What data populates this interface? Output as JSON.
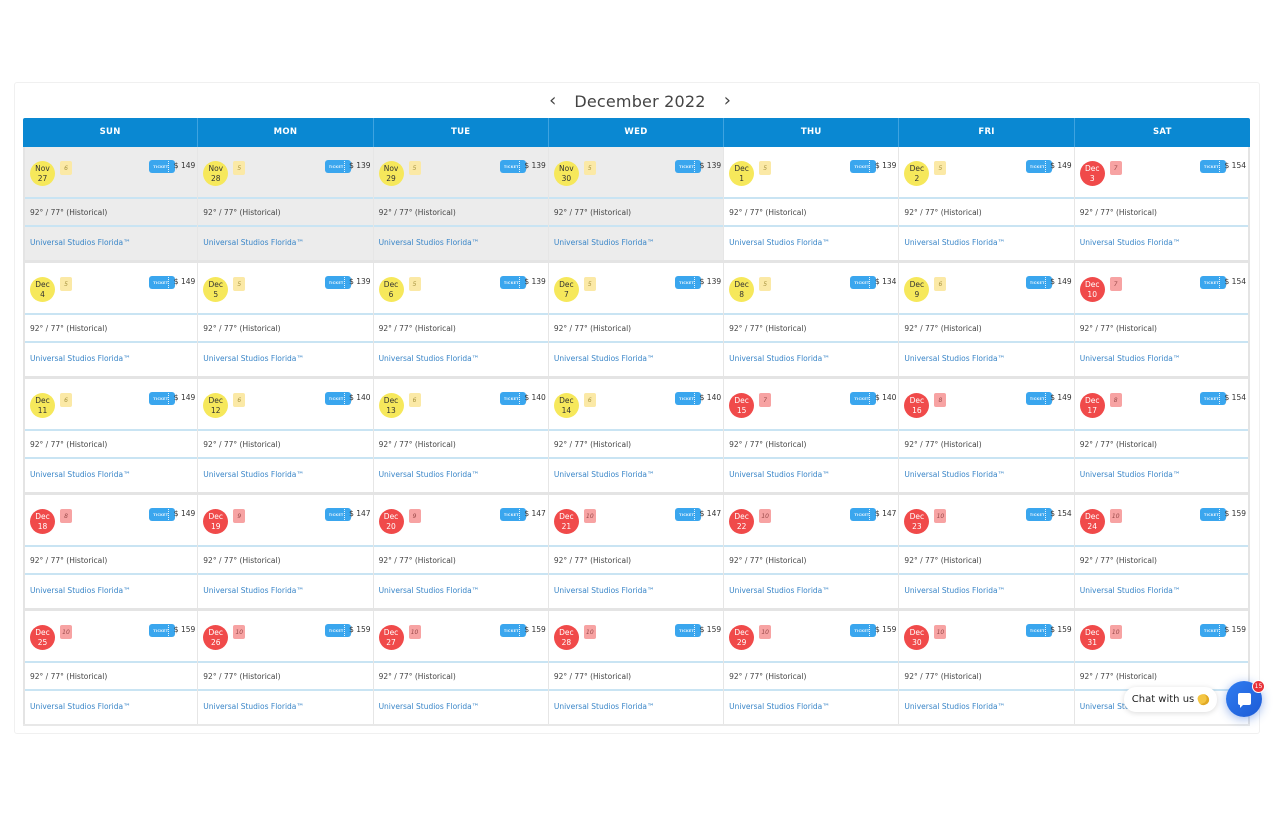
{
  "header": {
    "month_title": "December 2022",
    "prev_label": "‹",
    "next_label": "›"
  },
  "weekdays": [
    "SUN",
    "MON",
    "TUE",
    "WED",
    "THU",
    "FRI",
    "SAT"
  ],
  "colors": {
    "header_blue": "#0a88d2",
    "low_crowd_circle": "#f6e85b",
    "high_crowd_circle": "#f04a4a",
    "ticket_blue": "#3aa6ee",
    "park_link": "#3a86c8"
  },
  "ticket_icon_label": "TICKET",
  "weeks": [
    [
      {
        "month": "Nov",
        "day": "27",
        "crowd": "6",
        "level": "low",
        "price": "$ 149",
        "past": true,
        "weather": "92° / 77° (Historical)",
        "park": "Universal Studios Florida™"
      },
      {
        "month": "Nov",
        "day": "28",
        "crowd": "5",
        "level": "low",
        "price": "$ 139",
        "past": true,
        "weather": "92° / 77° (Historical)",
        "park": "Universal Studios Florida™"
      },
      {
        "month": "Nov",
        "day": "29",
        "crowd": "5",
        "level": "low",
        "price": "$ 139",
        "past": true,
        "weather": "92° / 77° (Historical)",
        "park": "Universal Studios Florida™"
      },
      {
        "month": "Nov",
        "day": "30",
        "crowd": "5",
        "level": "low",
        "price": "$ 139",
        "past": true,
        "weather": "92° / 77° (Historical)",
        "park": "Universal Studios Florida™"
      },
      {
        "month": "Dec",
        "day": "1",
        "crowd": "5",
        "level": "low",
        "price": "$ 139",
        "past": false,
        "weather": "92° / 77° (Historical)",
        "park": "Universal Studios Florida™"
      },
      {
        "month": "Dec",
        "day": "2",
        "crowd": "5",
        "level": "low",
        "price": "$ 149",
        "past": false,
        "weather": "92° / 77° (Historical)",
        "park": "Universal Studios Florida™"
      },
      {
        "month": "Dec",
        "day": "3",
        "crowd": "7",
        "level": "high",
        "price": "$ 154",
        "past": false,
        "weather": "92° / 77° (Historical)",
        "park": "Universal Studios Florida™"
      }
    ],
    [
      {
        "month": "Dec",
        "day": "4",
        "crowd": "5",
        "level": "low",
        "price": "$ 149",
        "past": false,
        "weather": "92° / 77° (Historical)",
        "park": "Universal Studios Florida™"
      },
      {
        "month": "Dec",
        "day": "5",
        "crowd": "5",
        "level": "low",
        "price": "$ 139",
        "past": false,
        "weather": "92° / 77° (Historical)",
        "park": "Universal Studios Florida™"
      },
      {
        "month": "Dec",
        "day": "6",
        "crowd": "5",
        "level": "low",
        "price": "$ 139",
        "past": false,
        "weather": "92° / 77° (Historical)",
        "park": "Universal Studios Florida™"
      },
      {
        "month": "Dec",
        "day": "7",
        "crowd": "5",
        "level": "low",
        "price": "$ 139",
        "past": false,
        "weather": "92° / 77° (Historical)",
        "park": "Universal Studios Florida™"
      },
      {
        "month": "Dec",
        "day": "8",
        "crowd": "5",
        "level": "low",
        "price": "$ 134",
        "past": false,
        "weather": "92° / 77° (Historical)",
        "park": "Universal Studios Florida™"
      },
      {
        "month": "Dec",
        "day": "9",
        "crowd": "6",
        "level": "low",
        "price": "$ 149",
        "past": false,
        "weather": "92° / 77° (Historical)",
        "park": "Universal Studios Florida™"
      },
      {
        "month": "Dec",
        "day": "10",
        "crowd": "7",
        "level": "high",
        "price": "$ 154",
        "past": false,
        "weather": "92° / 77° (Historical)",
        "park": "Universal Studios Florida™"
      }
    ],
    [
      {
        "month": "Dec",
        "day": "11",
        "crowd": "6",
        "level": "low",
        "price": "$ 149",
        "past": false,
        "weather": "92° / 77° (Historical)",
        "park": "Universal Studios Florida™"
      },
      {
        "month": "Dec",
        "day": "12",
        "crowd": "6",
        "level": "low",
        "price": "$ 140",
        "past": false,
        "weather": "92° / 77° (Historical)",
        "park": "Universal Studios Florida™"
      },
      {
        "month": "Dec",
        "day": "13",
        "crowd": "6",
        "level": "low",
        "price": "$ 140",
        "past": false,
        "weather": "92° / 77° (Historical)",
        "park": "Universal Studios Florida™"
      },
      {
        "month": "Dec",
        "day": "14",
        "crowd": "6",
        "level": "low",
        "price": "$ 140",
        "past": false,
        "weather": "92° / 77° (Historical)",
        "park": "Universal Studios Florida™"
      },
      {
        "month": "Dec",
        "day": "15",
        "crowd": "7",
        "level": "high",
        "price": "$ 140",
        "past": false,
        "weather": "92° / 77° (Historical)",
        "park": "Universal Studios Florida™"
      },
      {
        "month": "Dec",
        "day": "16",
        "crowd": "8",
        "level": "high",
        "price": "$ 149",
        "past": false,
        "weather": "92° / 77° (Historical)",
        "park": "Universal Studios Florida™"
      },
      {
        "month": "Dec",
        "day": "17",
        "crowd": "8",
        "level": "high",
        "price": "$ 154",
        "past": false,
        "weather": "92° / 77° (Historical)",
        "park": "Universal Studios Florida™"
      }
    ],
    [
      {
        "month": "Dec",
        "day": "18",
        "crowd": "8",
        "level": "high",
        "price": "$ 149",
        "past": false,
        "weather": "92° / 77° (Historical)",
        "park": "Universal Studios Florida™"
      },
      {
        "month": "Dec",
        "day": "19",
        "crowd": "9",
        "level": "high",
        "price": "$ 147",
        "past": false,
        "weather": "92° / 77° (Historical)",
        "park": "Universal Studios Florida™"
      },
      {
        "month": "Dec",
        "day": "20",
        "crowd": "9",
        "level": "high",
        "price": "$ 147",
        "past": false,
        "weather": "92° / 77° (Historical)",
        "park": "Universal Studios Florida™"
      },
      {
        "month": "Dec",
        "day": "21",
        "crowd": "10",
        "level": "high",
        "price": "$ 147",
        "past": false,
        "weather": "92° / 77° (Historical)",
        "park": "Universal Studios Florida™"
      },
      {
        "month": "Dec",
        "day": "22",
        "crowd": "10",
        "level": "high",
        "price": "$ 147",
        "past": false,
        "weather": "92° / 77° (Historical)",
        "park": "Universal Studios Florida™"
      },
      {
        "month": "Dec",
        "day": "23",
        "crowd": "10",
        "level": "high",
        "price": "$ 154",
        "past": false,
        "weather": "92° / 77° (Historical)",
        "park": "Universal Studios Florida™"
      },
      {
        "month": "Dec",
        "day": "24",
        "crowd": "10",
        "level": "high",
        "price": "$ 159",
        "past": false,
        "weather": "92° / 77° (Historical)",
        "park": "Universal Studios Florida™"
      }
    ],
    [
      {
        "month": "Dec",
        "day": "25",
        "crowd": "10",
        "level": "high",
        "price": "$ 159",
        "past": false,
        "weather": "92° / 77° (Historical)",
        "park": "Universal Studios Florida™"
      },
      {
        "month": "Dec",
        "day": "26",
        "crowd": "10",
        "level": "high",
        "price": "$ 159",
        "past": false,
        "weather": "92° / 77° (Historical)",
        "park": "Universal Studios Florida™"
      },
      {
        "month": "Dec",
        "day": "27",
        "crowd": "10",
        "level": "high",
        "price": "$ 159",
        "past": false,
        "weather": "92° / 77° (Historical)",
        "park": "Universal Studios Florida™"
      },
      {
        "month": "Dec",
        "day": "28",
        "crowd": "10",
        "level": "high",
        "price": "$ 159",
        "past": false,
        "weather": "92° / 77° (Historical)",
        "park": "Universal Studios Florida™"
      },
      {
        "month": "Dec",
        "day": "29",
        "crowd": "10",
        "level": "high",
        "price": "$ 159",
        "past": false,
        "weather": "92° / 77° (Historical)",
        "park": "Universal Studios Florida™"
      },
      {
        "month": "Dec",
        "day": "30",
        "crowd": "10",
        "level": "high",
        "price": "$ 159",
        "past": false,
        "weather": "92° / 77° (Historical)",
        "park": "Universal Studios Florida™"
      },
      {
        "month": "Dec",
        "day": "31",
        "crowd": "10",
        "level": "high",
        "price": "$ 159",
        "past": false,
        "weather": "92° / 77° (Historical)",
        "park": "Universal Studios Florida™"
      }
    ]
  ],
  "chat": {
    "label": "Chat with us",
    "icon": "waving-hand-icon",
    "badge_count": "15"
  }
}
